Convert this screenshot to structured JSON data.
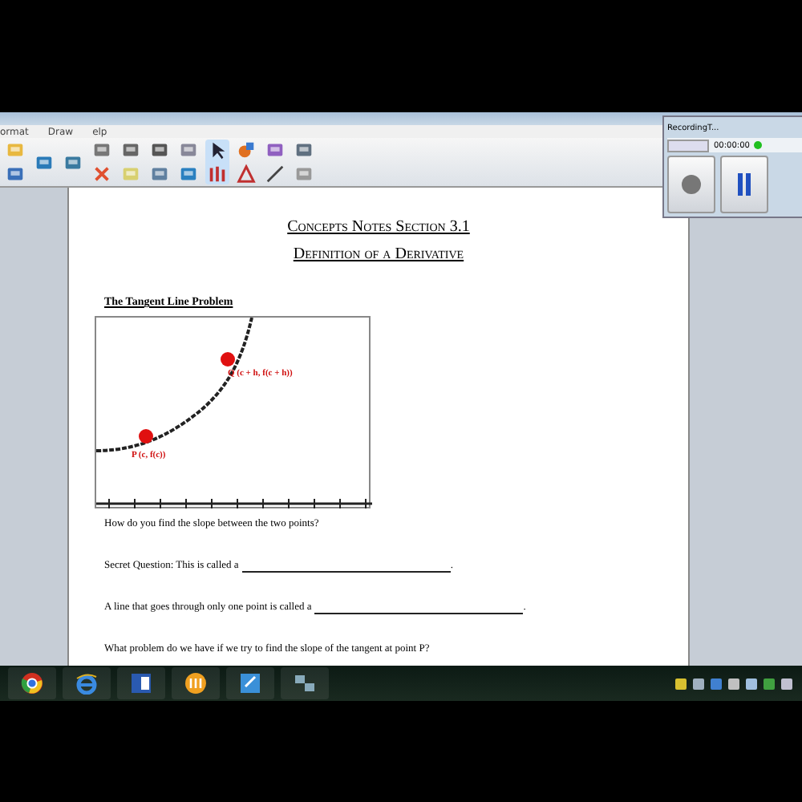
{
  "app": {
    "menu": [
      "ormat",
      "Draw",
      "elp"
    ]
  },
  "document": {
    "title": "Concepts Notes Section 3.1",
    "subtitle": "Definition of a Derivative",
    "heading": "The Tangent Line Problem",
    "graph": {
      "points": [
        {
          "label": "Q (c + h, f(c + h))"
        },
        {
          "label": "P (c, f(c))"
        }
      ]
    },
    "questions": [
      {
        "text": "How do you find the slope between the two points?",
        "blank": false
      },
      {
        "text": "Secret Question:  This is called a",
        "blank": true,
        "after": "."
      },
      {
        "text": "A line that goes through only one point is called a",
        "blank": true,
        "after": "."
      },
      {
        "text": "What problem do we have if we try to find the slope of the tangent at point P?",
        "blank": false
      }
    ]
  },
  "recorder": {
    "title": "RecordingT...",
    "timer": "00:00:00"
  }
}
